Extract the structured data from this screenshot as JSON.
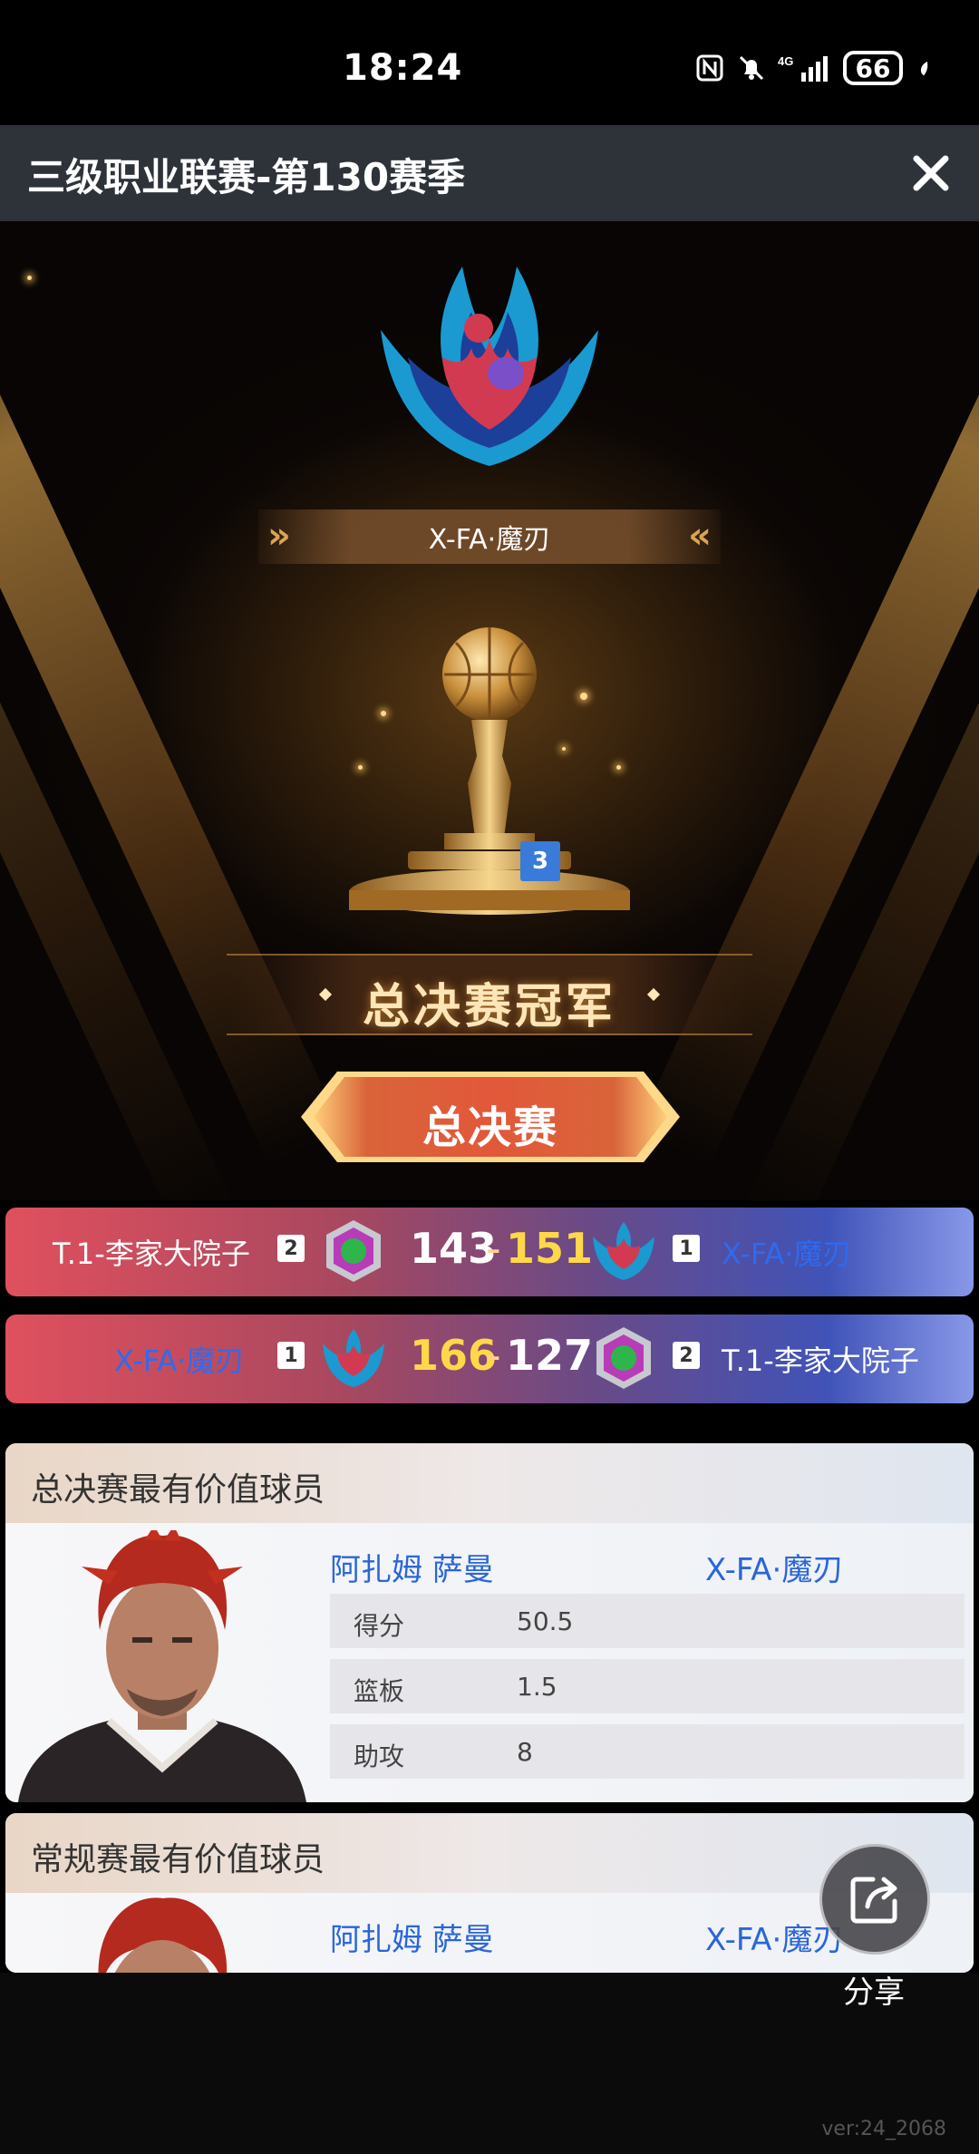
{
  "status_bar": {
    "time": "18:24",
    "network": "4G",
    "battery": "66"
  },
  "header": {
    "title": "三级职业联赛-第130赛季",
    "close_icon": "close-icon"
  },
  "champion": {
    "team_name": "X-FA·魔刃",
    "trophy_badge": "3",
    "title": "总决赛冠军"
  },
  "finals_button": {
    "label": "总决赛"
  },
  "matches": [
    {
      "left": {
        "name": "T.1-李家大院子",
        "seed": "2"
      },
      "score_left": "143",
      "score_right": "151",
      "separator": "-",
      "right": {
        "name": "X-FA·魔刃",
        "seed": "1"
      }
    },
    {
      "left": {
        "name": "X-FA·魔刃",
        "seed": "1"
      },
      "score_left": "166",
      "score_right": "127",
      "separator": "-",
      "right": {
        "name": "T.1-李家大院子",
        "seed": "2"
      }
    }
  ],
  "finals_mvp": {
    "title": "总决赛最有价值球员",
    "player": "阿扎姆 萨曼",
    "team": "X-FA·魔刃",
    "stats": [
      {
        "label": "得分",
        "value": "50.5"
      },
      {
        "label": "篮板",
        "value": "1.5"
      },
      {
        "label": "助攻",
        "value": "8"
      }
    ]
  },
  "regular_mvp": {
    "title": "常规赛最有价值球员",
    "player": "阿扎姆 萨曼",
    "team": "X-FA·魔刃"
  },
  "share": {
    "label": "分享",
    "icon": "share-icon"
  },
  "version": "ver:24_2068",
  "colors": {
    "title_bar": "#2e333a",
    "link_blue": "#2a66d8",
    "win_gold": "#ffd84a",
    "badge_blue": "#3a7ad8"
  }
}
